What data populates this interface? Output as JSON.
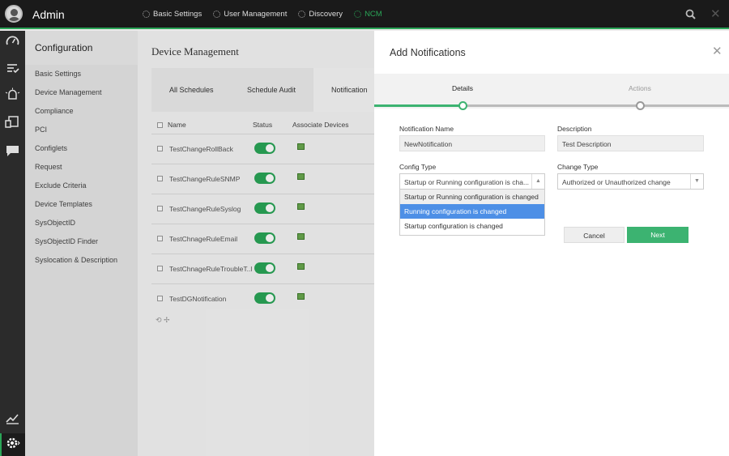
{
  "app": {
    "title": "Admin"
  },
  "topnav": [
    {
      "label": "Basic Settings",
      "icon": "gear-icon"
    },
    {
      "label": "User Management",
      "icon": "gear-icon"
    },
    {
      "label": "Discovery",
      "icon": "gear-icon"
    },
    {
      "label": "NCM",
      "icon": "gear-icon",
      "active": true
    }
  ],
  "rail": {
    "icons": [
      "dashboard-icon",
      "alarms-list-icon",
      "alert-icon",
      "devices-icon",
      "chat-icon",
      "reports-icon",
      "settings-icon"
    ]
  },
  "sidebar": {
    "heading": "Configuration",
    "items": [
      "Basic Settings",
      "Device Management",
      "Compliance",
      "PCI",
      "Configlets",
      "Request",
      "Exclude Criteria",
      "Device Templates",
      "SysObjectID",
      "SysObjectID Finder",
      "Syslocation & Description"
    ]
  },
  "main": {
    "title": "Device Management",
    "tabs": [
      "All Schedules",
      "Schedule Audit",
      "Notification"
    ],
    "columns": [
      "Name",
      "Status",
      "Associate Devices"
    ],
    "rows": [
      {
        "name": "TestChangeRollBack"
      },
      {
        "name": "TestChangeRuleSNMP"
      },
      {
        "name": "TestChangeRuleSyslog"
      },
      {
        "name": "TestChnageRuleEmail"
      },
      {
        "name": "TestChnageRuleTroubleT..l"
      },
      {
        "name": "TestDGNotification"
      }
    ]
  },
  "panel": {
    "title": "Add Notifications",
    "steps": [
      "Details",
      "Actions"
    ],
    "fields": {
      "notification_name_label": "Notification Name",
      "notification_name_value": "NewNotification",
      "description_label": "Description",
      "description_value": "Test Description",
      "config_type_label": "Config Type",
      "config_type_value": "Startup or Running configuration is cha...",
      "change_type_label": "Change Type",
      "change_type_value": "Authorized or Unauthorized change"
    },
    "config_type_options": [
      "Startup or Running configuration is changed",
      "Running configuration is changed",
      "Startup configuration is changed"
    ],
    "buttons": {
      "cancel": "Cancel",
      "next": "Next"
    }
  },
  "colors": {
    "accent": "#2aa557",
    "selected": "#4d8fe6",
    "next_button": "#3cb371",
    "topbar": "#1a1a1a"
  }
}
